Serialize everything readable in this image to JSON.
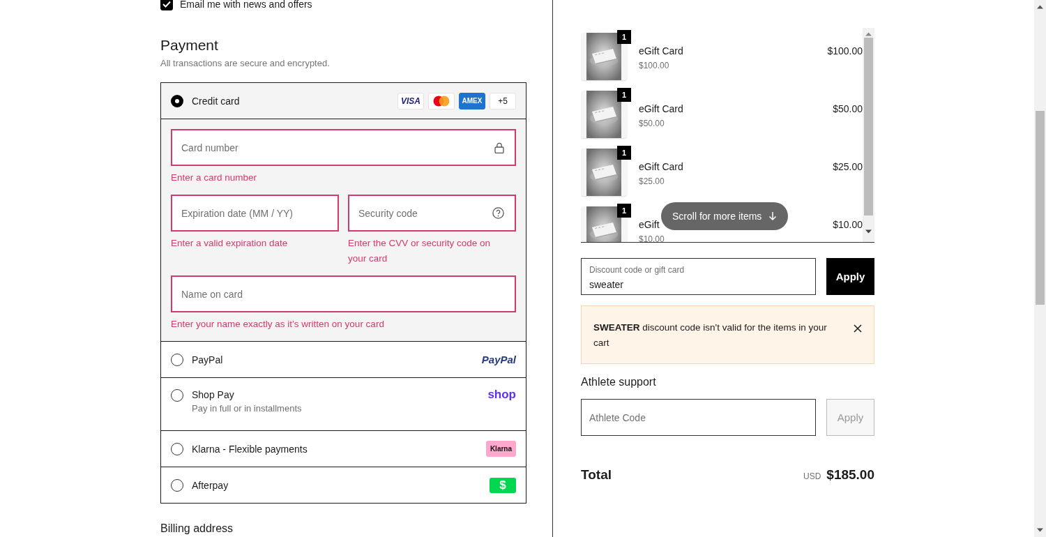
{
  "newsletter": {
    "label": "Email me with news and offers",
    "checked": true
  },
  "payment": {
    "title": "Payment",
    "subtitle": "All transactions are secure and encrypted.",
    "methods": [
      {
        "kind": "card",
        "label": "Credit card",
        "selected": true,
        "brands": [
          {
            "kind": "visa",
            "text": "VISA"
          },
          {
            "kind": "mastercard"
          },
          {
            "kind": "amex",
            "text": "AMEX"
          }
        ],
        "more": "+5"
      },
      {
        "kind": "paypal",
        "label": "PayPal",
        "selected": false,
        "logo_text": "PayPal"
      },
      {
        "kind": "shop_pay",
        "label": "Shop Pay",
        "note": "Pay in full or in installments",
        "selected": false,
        "logo_text": "shop"
      },
      {
        "kind": "klarna",
        "label": "Klarna - Flexible payments",
        "selected": false,
        "logo_text": "Klarna"
      },
      {
        "kind": "afterpay",
        "label": "Afterpay",
        "selected": false,
        "logo_text": "$"
      }
    ]
  },
  "card_form": {
    "fields": [
      {
        "kind": "card_number",
        "placeholder": "Card number",
        "invalid": true,
        "error": "Enter a card number"
      },
      {
        "kind": "expiry",
        "placeholder": "Expiration date (MM / YY)",
        "invalid": true,
        "error": "Enter a valid expiration date"
      },
      {
        "kind": "security_code",
        "placeholder": "Security code",
        "invalid": true,
        "error": "Enter the CVV or security code on your card"
      },
      {
        "kind": "name",
        "placeholder": "Name on card",
        "invalid": true,
        "error": "Enter your name exactly as it’s written on your card"
      }
    ]
  },
  "billing": {
    "title": "Billing address"
  },
  "cart": {
    "items": [
      {
        "quantity": "1",
        "name": "eGift Card",
        "unit_price": "$100.00",
        "price": "$100.00"
      },
      {
        "quantity": "1",
        "name": "eGift Card",
        "unit_price": "$50.00",
        "price": "$50.00"
      },
      {
        "quantity": "1",
        "name": "eGift Card",
        "unit_price": "$25.00",
        "price": "$25.00"
      },
      {
        "quantity": "1",
        "name": "eGift",
        "unit_price": "$10.00",
        "price": "$10.00"
      }
    ],
    "scroll_hint": "Scroll for more items"
  },
  "discount": {
    "label": "Discount code or gift card",
    "value": "sweater",
    "button": "Apply",
    "button_disabled": false
  },
  "alert": {
    "message": "**SWEATER** discount code isn't valid for the items in your cart"
  },
  "athlete": {
    "title": "Athlete support",
    "placeholder": "Athlete Code",
    "button": "Apply",
    "button_disabled": true
  },
  "total": {
    "label": "Total",
    "currency": "USD",
    "amount": "$185.00"
  }
}
